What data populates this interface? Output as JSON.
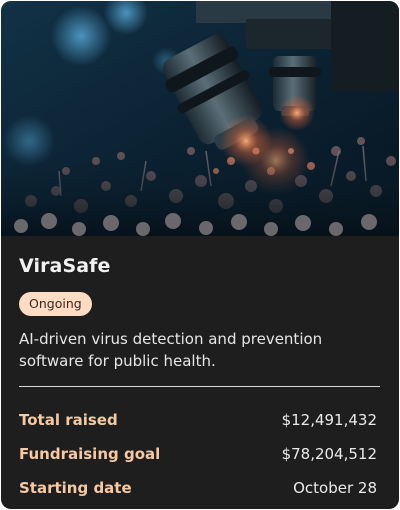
{
  "card": {
    "image_icon": "microscope-virus-photo",
    "title": "ViraSafe",
    "status_badge": "Ongoing",
    "description": "AI-driven virus detection and prevention software for public health.",
    "stats": [
      {
        "label": "Total raised",
        "value": "$12,491,432"
      },
      {
        "label": "Fundraising goal",
        "value": "$78,204,512"
      },
      {
        "label": "Starting date",
        "value": "October 28"
      }
    ]
  },
  "colors": {
    "card_background": "#1e1e1e",
    "badge_background": "#ffdcc3",
    "label_accent": "#f6c9a4"
  }
}
